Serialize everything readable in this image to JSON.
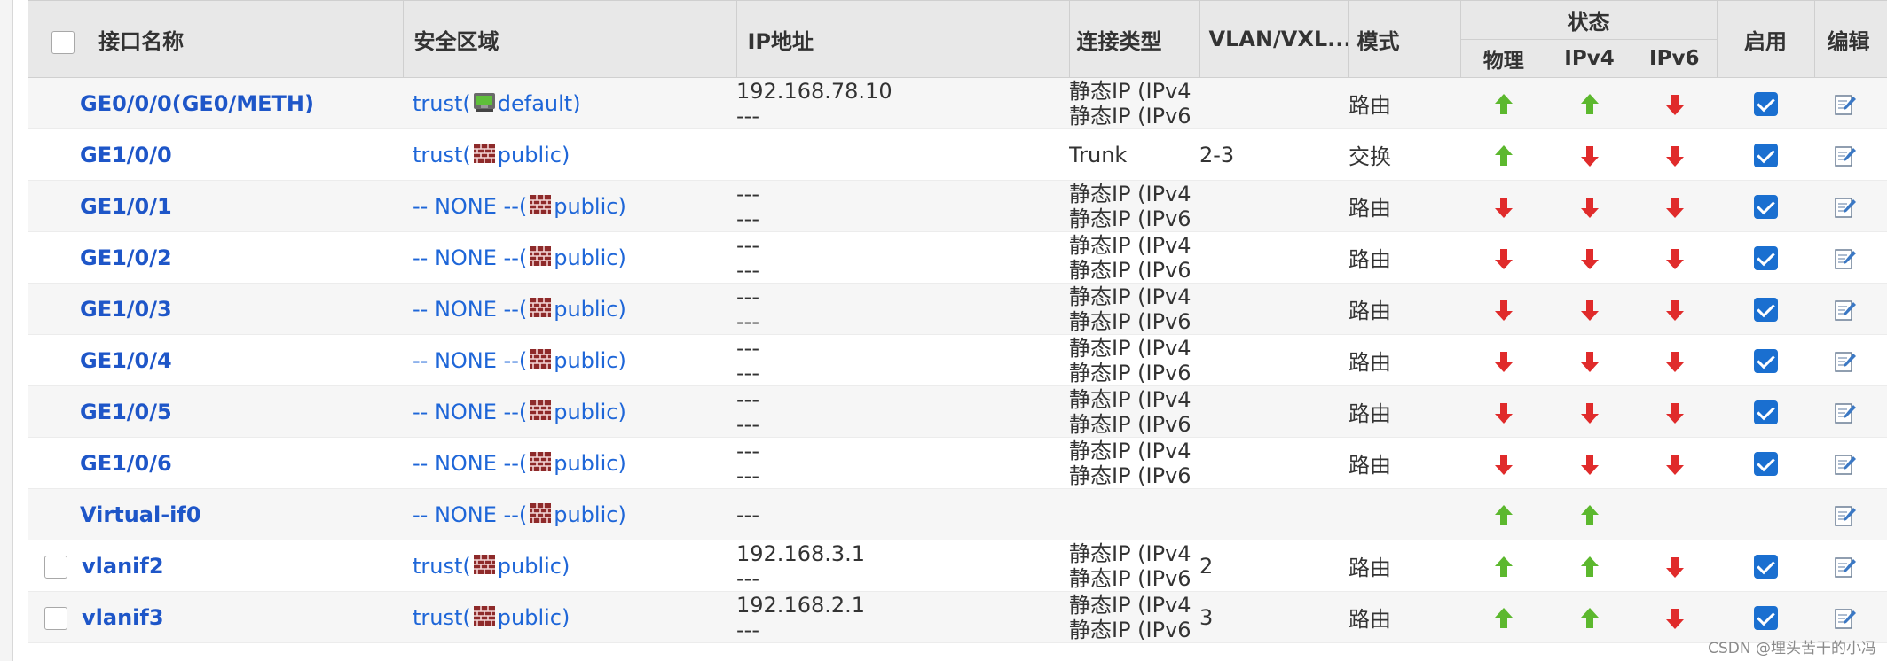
{
  "headers": {
    "name": "接口名称",
    "zone": "安全区域",
    "ip": "IP地址",
    "conn_type": "连接类型",
    "vlan": "VLAN/VXL...",
    "mode": "模式",
    "status": "状态",
    "physical": "物理",
    "ipv4": "IPv4",
    "ipv6": "IPv6",
    "enable": "启用",
    "edit": "编辑"
  },
  "rows": [
    {
      "checkbox": false,
      "name": "GE0/0/0(GE0/METH)",
      "zone_prefix": "trust(",
      "zone_icon": "manage-zone-icon",
      "zone_suffix": "default)",
      "ip1": "192.168.78.10",
      "ip2": "---",
      "type1": "静态IP (IPv4",
      "type2": "静态IP (IPv6",
      "vlan": "",
      "mode": "路由",
      "phys": "up",
      "v4": "up",
      "v6": "down",
      "enabled": true,
      "edit": true
    },
    {
      "checkbox": false,
      "name": "GE1/0/0",
      "zone_prefix": "trust(",
      "zone_icon": "firewall-icon",
      "zone_suffix": "public)",
      "ip1": "",
      "ip2": "",
      "type1": "Trunk",
      "type2": "",
      "vlan": "2-3",
      "mode": "交换",
      "phys": "up",
      "v4": "down",
      "v6": "down",
      "enabled": true,
      "edit": true
    },
    {
      "checkbox": false,
      "name": "GE1/0/1",
      "zone_prefix": "-- NONE --(",
      "zone_icon": "firewall-icon",
      "zone_suffix": "public)",
      "ip1": "---",
      "ip2": "---",
      "type1": "静态IP (IPv4",
      "type2": "静态IP (IPv6",
      "vlan": "",
      "mode": "路由",
      "phys": "down",
      "v4": "down",
      "v6": "down",
      "enabled": true,
      "edit": true
    },
    {
      "checkbox": false,
      "name": "GE1/0/2",
      "zone_prefix": "-- NONE --(",
      "zone_icon": "firewall-icon",
      "zone_suffix": "public)",
      "ip1": "---",
      "ip2": "---",
      "type1": "静态IP (IPv4",
      "type2": "静态IP (IPv6",
      "vlan": "",
      "mode": "路由",
      "phys": "down",
      "v4": "down",
      "v6": "down",
      "enabled": true,
      "edit": true
    },
    {
      "checkbox": false,
      "name": "GE1/0/3",
      "zone_prefix": "-- NONE --(",
      "zone_icon": "firewall-icon",
      "zone_suffix": "public)",
      "ip1": "---",
      "ip2": "---",
      "type1": "静态IP (IPv4",
      "type2": "静态IP (IPv6",
      "vlan": "",
      "mode": "路由",
      "phys": "down",
      "v4": "down",
      "v6": "down",
      "enabled": true,
      "edit": true
    },
    {
      "checkbox": false,
      "name": "GE1/0/4",
      "zone_prefix": "-- NONE --(",
      "zone_icon": "firewall-icon",
      "zone_suffix": "public)",
      "ip1": "---",
      "ip2": "---",
      "type1": "静态IP (IPv4",
      "type2": "静态IP (IPv6",
      "vlan": "",
      "mode": "路由",
      "phys": "down",
      "v4": "down",
      "v6": "down",
      "enabled": true,
      "edit": true
    },
    {
      "checkbox": false,
      "name": "GE1/0/5",
      "zone_prefix": "-- NONE --(",
      "zone_icon": "firewall-icon",
      "zone_suffix": "public)",
      "ip1": "---",
      "ip2": "---",
      "type1": "静态IP (IPv4",
      "type2": "静态IP (IPv6",
      "vlan": "",
      "mode": "路由",
      "phys": "down",
      "v4": "down",
      "v6": "down",
      "enabled": true,
      "edit": true
    },
    {
      "checkbox": false,
      "name": "GE1/0/6",
      "zone_prefix": "-- NONE --(",
      "zone_icon": "firewall-icon",
      "zone_suffix": "public)",
      "ip1": "---",
      "ip2": "---",
      "type1": "静态IP (IPv4",
      "type2": "静态IP (IPv6",
      "vlan": "",
      "mode": "路由",
      "phys": "down",
      "v4": "down",
      "v6": "down",
      "enabled": true,
      "edit": true
    },
    {
      "checkbox": false,
      "name": "Virtual-if0",
      "zone_prefix": "-- NONE --(",
      "zone_icon": "firewall-icon",
      "zone_suffix": "public)",
      "ip1": "---",
      "ip2": "",
      "type1": "",
      "type2": "",
      "vlan": "",
      "mode": "",
      "phys": "up",
      "v4": "up",
      "v6": "",
      "enabled": false,
      "edit": true
    },
    {
      "checkbox": true,
      "name": "vlanif2",
      "zone_prefix": "trust(",
      "zone_icon": "firewall-icon",
      "zone_suffix": "public)",
      "ip1": "192.168.3.1",
      "ip2": "---",
      "type1": "静态IP (IPv4",
      "type2": "静态IP (IPv6",
      "vlan": "2",
      "mode": "路由",
      "phys": "up",
      "v4": "up",
      "v6": "down",
      "enabled": true,
      "edit": true
    },
    {
      "checkbox": true,
      "name": "vlanif3",
      "zone_prefix": "trust(",
      "zone_icon": "firewall-icon",
      "zone_suffix": "public)",
      "ip1": "192.168.2.1",
      "ip2": "---",
      "type1": "静态IP (IPv4",
      "type2": "静态IP (IPv6",
      "vlan": "3",
      "mode": "路由",
      "phys": "up",
      "v4": "up",
      "v6": "down",
      "enabled": true,
      "edit": true
    }
  ],
  "watermark": "CSDN @埋头苦干的小冯",
  "colors": {
    "up": "#5cb82e",
    "down": "#e02b2b",
    "link": "#1e56c8",
    "check": "#1a6fd0"
  }
}
